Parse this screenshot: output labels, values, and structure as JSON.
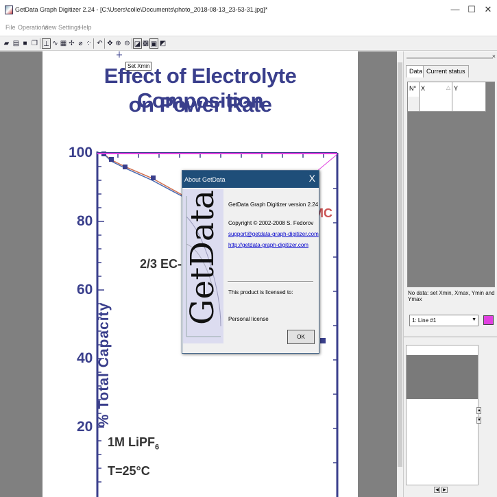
{
  "window": {
    "title": "GetData Graph Digitizer 2.24 - [C:\\Users\\colle\\Documents\\photo_2018-08-13_23-53-31.jpg]*",
    "minimize": "—",
    "maximize": "☐",
    "close": "✕"
  },
  "menu": [
    "File",
    "Operations",
    "View",
    "Settings",
    "Help"
  ],
  "toolbar_icons": [
    "open-icon",
    "save-icon",
    "floppy-icon",
    "copy-icon",
    "axis-icon",
    "line-icon",
    "area-icon",
    "point-icon",
    "eraser-icon",
    "dots-icon",
    "undo-icon",
    "move-icon",
    "zoom-in-icon",
    "zoom-out-icon",
    "image-icon",
    "grid-icon",
    "fit-icon",
    "scale-icon"
  ],
  "tooltip": "Set Xmin",
  "image": {
    "title_line1": "Effect of Electrolyte Composition",
    "title_line2": "on Power Rate",
    "ylabel": "% Total Capacity",
    "yticks": [
      "100",
      "80",
      "60",
      "40",
      "20"
    ],
    "legend_text": "2/3  EC-",
    "legend_right": "MC",
    "salt": "1M  LiPF",
    "salt_sub": "6",
    "temp": "T=25°C"
  },
  "right_panel": {
    "tabs": [
      "Data",
      "Current status"
    ],
    "grid_headers": [
      "N°",
      "X",
      "Y"
    ],
    "status_text": "No data: set Xmin, Xmax, Ymin and Ymax",
    "line_select": "1: Line #1",
    "line_color": "#e040e0",
    "close_glyph": "×"
  },
  "about_dialog": {
    "title": "About GetData",
    "close": "X",
    "logo": "GetData",
    "version": "GetData Graph Digitizer version 2.24",
    "copyright": "Copyright © 2002-2008 S. Fedorov",
    "email": "support@getdata-graph-digitizer.com",
    "url": "http://getdata-graph-digitizer.com",
    "license_label": "This product is licensed to:",
    "license": "Personal license",
    "ok": "OK"
  }
}
